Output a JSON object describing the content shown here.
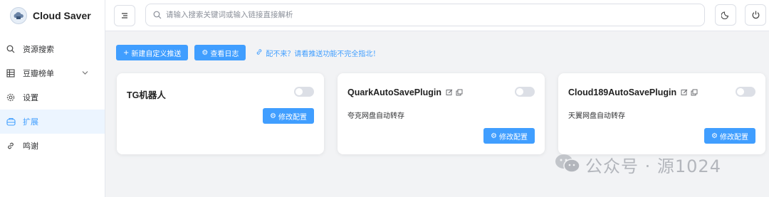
{
  "app": {
    "title": "Cloud Saver"
  },
  "sidebar": {
    "items": [
      {
        "label": "资源搜索",
        "icon": "search-icon"
      },
      {
        "label": "豆瓣榜单",
        "icon": "grid-icon"
      },
      {
        "label": "设置",
        "icon": "gear-icon"
      },
      {
        "label": "扩展",
        "icon": "extension-icon"
      },
      {
        "label": "鸣谢",
        "icon": "link-icon"
      }
    ],
    "active_index": 3
  },
  "search": {
    "placeholder": "请输入搜索关键词或输入链接直接解析",
    "value": ""
  },
  "toolbar": {
    "new_push_label": "新建自定义推送",
    "view_log_label": "查看日志",
    "tip": "配不来？请看推送功能不完全指北！"
  },
  "cards": [
    {
      "name": "TG机器人",
      "desc": "",
      "enabled": false,
      "config_label": "修改配置"
    },
    {
      "name": "QuarkAutoSavePlugin",
      "desc": "夸克网盘自动转存",
      "enabled": false,
      "config_label": "修改配置"
    },
    {
      "name": "Cloud189AutoSavePlugin",
      "desc": "天翼网盘自动转存",
      "enabled": false,
      "config_label": "修改配置"
    }
  ],
  "watermark": {
    "text": "公众号 · 源1024"
  },
  "colors": {
    "primary": "#409eff",
    "active_bg": "#ecf5ff",
    "background": "#f2f3f5"
  }
}
